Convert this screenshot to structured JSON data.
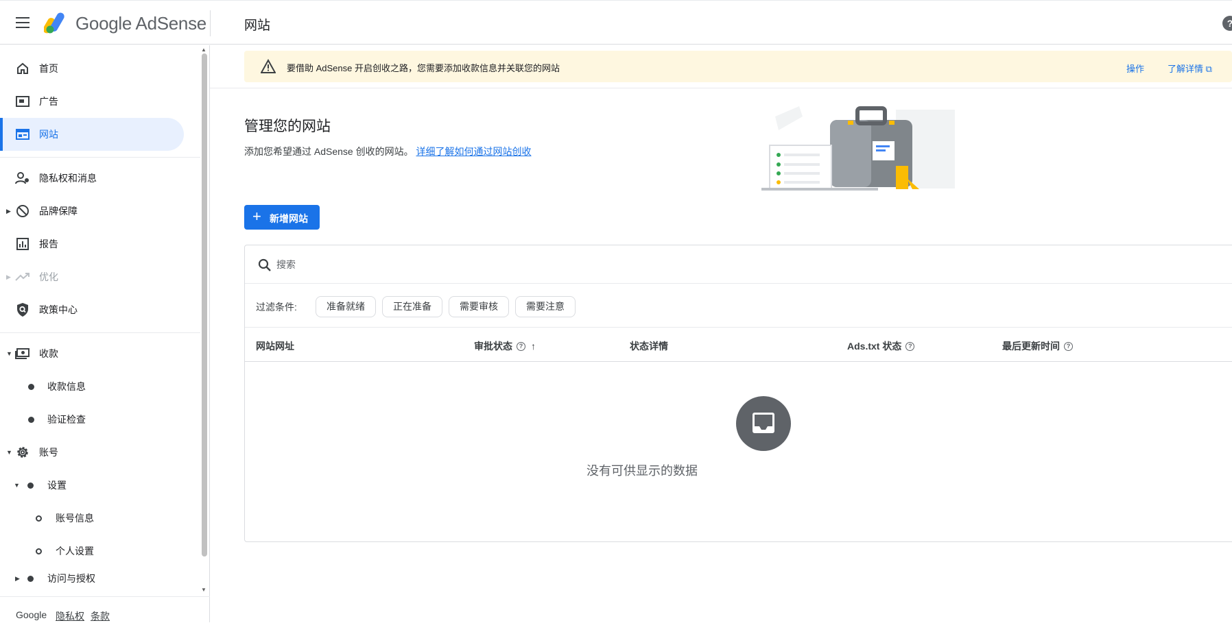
{
  "app": {
    "brand": "Google AdSense",
    "page_title": "网站"
  },
  "sidebar": {
    "items": [
      {
        "label": "首页",
        "icon": "home-icon"
      },
      {
        "label": "广告",
        "icon": "ads-icon"
      },
      {
        "label": "网站",
        "icon": "sites-icon",
        "active": true
      },
      {
        "label": "隐私权和消息",
        "icon": "privacy-icon"
      },
      {
        "label": "品牌保障",
        "icon": "block-icon"
      },
      {
        "label": "报告",
        "icon": "reports-icon"
      },
      {
        "label": "优化",
        "icon": "optimize-icon",
        "disabled": true
      },
      {
        "label": "政策中心",
        "icon": "policy-icon"
      },
      {
        "label": "收款",
        "icon": "payments-icon"
      },
      {
        "label": "收款信息"
      },
      {
        "label": "验证检查"
      },
      {
        "label": "账号",
        "icon": "gear-icon"
      },
      {
        "label": "设置"
      },
      {
        "label": "账号信息"
      },
      {
        "label": "个人设置"
      },
      {
        "label": "访问与授权"
      }
    ]
  },
  "footer": {
    "google": "Google",
    "privacy": "隐私权",
    "terms": "条款"
  },
  "banner": {
    "text": "要借助 AdSense 开启创收之路，您需要添加收款信息并关联您的网站",
    "action": "操作",
    "learn_more": "了解详情"
  },
  "main": {
    "heading": "管理您的网站",
    "description": "添加您希望通过 AdSense 创收的网站。",
    "description_link": "详细了解如何通过网站创收",
    "add_button": "新增网站"
  },
  "table": {
    "search_placeholder": "搜索",
    "filter_label": "过滤条件:",
    "filters": [
      "准备就绪",
      "正在准备",
      "需要审核",
      "需要注意"
    ],
    "columns": [
      "网站网址",
      "审批状态",
      "状态详情",
      "Ads.txt 状态",
      "最后更新时间"
    ],
    "empty_text": "没有可供显示的数据"
  },
  "colors": {
    "accent": "#1a73e8",
    "banner_bg": "#fef7e0",
    "active_bg": "#e8f0fe"
  }
}
